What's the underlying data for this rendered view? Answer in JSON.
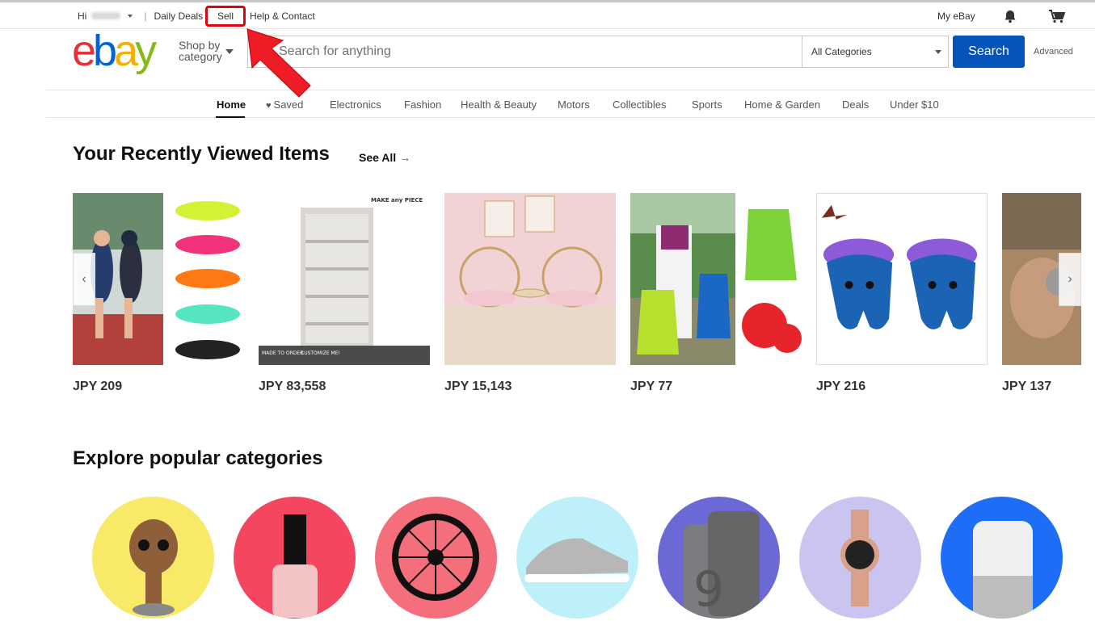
{
  "topbar": {
    "greeting": "Hi",
    "daily_deals": "Daily Deals",
    "sell": "Sell",
    "help_contact": "Help & Contact",
    "my_ebay": "My eBay"
  },
  "header": {
    "logo_letters": [
      "e",
      "b",
      "a",
      "y"
    ],
    "shop_by_line1": "Shop by",
    "shop_by_line2": "category",
    "search_placeholder": "Search for anything",
    "category_selected": "All Categories",
    "search_button": "Search",
    "advanced_link": "Advanced"
  },
  "nav": {
    "items": [
      {
        "label": "Home",
        "active": true
      },
      {
        "label": "Saved",
        "icon": "heart-icon"
      },
      {
        "label": "Electronics"
      },
      {
        "label": "Fashion"
      },
      {
        "label": "Health & Beauty"
      },
      {
        "label": "Motors"
      },
      {
        "label": "Collectibles"
      },
      {
        "label": "Sports"
      },
      {
        "label": "Home & Garden"
      },
      {
        "label": "Deals"
      },
      {
        "label": "Under $10"
      }
    ]
  },
  "recently_viewed": {
    "title": "Your Recently Viewed Items",
    "see_all": "See All",
    "items": [
      {
        "price": "JPY 209",
        "image": "water-shoes-image"
      },
      {
        "price": "JPY 83,558",
        "image": "shelf-image",
        "overlay_text": "MAKE any PIECE",
        "banner_a": "MADE TO ORDER",
        "banner_b": "CUSTOMIZE ME!"
      },
      {
        "price": "JPY 15,143",
        "image": "chairs-image"
      },
      {
        "price": "JPY 77",
        "image": "shopping-bags-image"
      },
      {
        "price": "JPY 216",
        "image": "squishy-toy-image"
      },
      {
        "price": "JPY 137",
        "image": "watch-photo-image"
      }
    ]
  },
  "explore": {
    "title": "Explore popular categories",
    "categories": [
      {
        "image": "groot-figure-image",
        "bg": "#f8e968"
      },
      {
        "image": "nail-polish-image",
        "bg": "#f4475f"
      },
      {
        "image": "wheel-image",
        "bg": "#f46f7b"
      },
      {
        "image": "sneaker-image",
        "bg": "#bdf0f8"
      },
      {
        "image": "phone-image",
        "bg": "#6a69d6"
      },
      {
        "image": "watch-image",
        "bg": "#c9c5f0"
      },
      {
        "image": "smart-speaker-image",
        "bg": "#1e6df7"
      }
    ]
  },
  "colors": {
    "search_button": "#0654ba",
    "highlight_red": "#e3010f"
  }
}
